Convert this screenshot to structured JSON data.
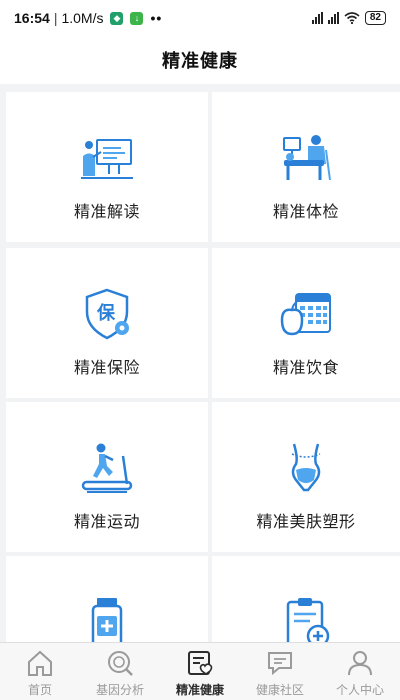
{
  "status": {
    "time": "16:54",
    "net_speed": "1.0M/s",
    "battery": "82",
    "more": "••"
  },
  "header": {
    "title": "精准健康"
  },
  "tiles": [
    {
      "label": "精准解读",
      "icon": "presentation-board-icon"
    },
    {
      "label": "精准体检",
      "icon": "medical-checkup-icon"
    },
    {
      "label": "精准保险",
      "icon": "insurance-shield-icon"
    },
    {
      "label": "精准饮食",
      "icon": "diet-calendar-icon"
    },
    {
      "label": "精准运动",
      "icon": "treadmill-icon"
    },
    {
      "label": "精准美肤塑形",
      "icon": "body-shaping-icon"
    },
    {
      "label": "",
      "icon": "medicine-bottle-icon"
    },
    {
      "label": "",
      "icon": "medical-clipboard-icon"
    }
  ],
  "tabs": [
    {
      "label": "首页",
      "icon": "home-icon",
      "active": false
    },
    {
      "label": "基因分析",
      "icon": "gene-analysis-icon",
      "active": false
    },
    {
      "label": "精准健康",
      "icon": "health-heart-icon",
      "active": true
    },
    {
      "label": "健康社区",
      "icon": "community-chat-icon",
      "active": false
    },
    {
      "label": "个人中心",
      "icon": "profile-icon",
      "active": false
    }
  ],
  "colors": {
    "accent": "#2a7fd6",
    "accent_light": "#4fa6ee",
    "tab_inactive": "#9a9a9a",
    "page_bg": "#f2f3f5"
  }
}
